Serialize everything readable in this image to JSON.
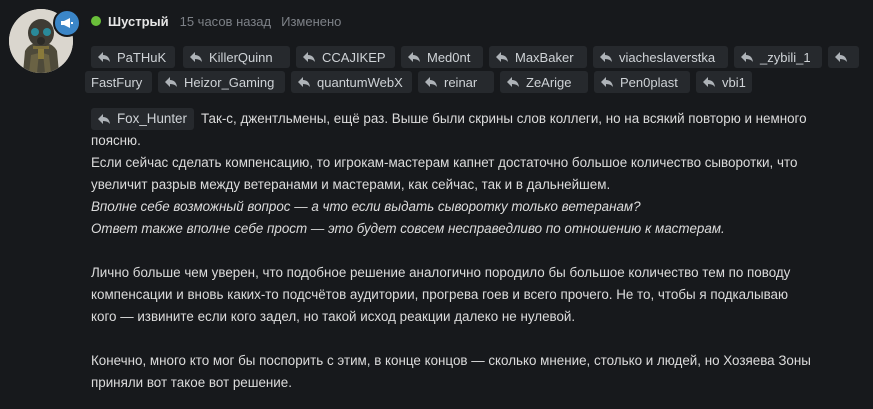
{
  "post": {
    "author": "Шустрый",
    "time": "15 часов назад",
    "edited": "Изменено",
    "mentions": [
      "PaTHuK",
      "KillerQuinn",
      "CCAJIKEP",
      "Med0nt",
      "MaxBaker",
      "viacheslaverstka",
      "_zybili_1",
      "",
      "FastFury",
      "Heizor_Gaming",
      "quantumWebX",
      "reinar",
      "ZeArige",
      "Pen0plast",
      "vbi1"
    ],
    "lead_mention": "Fox_Hunter",
    "p1_line1": "Так-с, джентльмены, ещё раз. Выше были скрины слов коллеги, но на всякий повторю и немного",
    "p1_line2": "поясню.",
    "p1_line3": "Если сейчас сделать компенсацию, то игрокам-мастерам капнет достаточно большое количество сыворотки, что",
    "p1_line4": "увеличит разрыв между ветеранами и мастерами, как сейчас, так и в дальнейшем.",
    "p1_line5": "Вполне себе возможный вопрос — а что если выдать сыворотку только ветеранам?",
    "p1_line6": "Ответ также вполне себе прост — это будет совсем несправедливо по отношению к мастерам.",
    "p2_line1": "Лично больше чем уверен, что подобное решение аналогично породило бы большое количество тем по поводу",
    "p2_line2": "компенсации и вновь каких-то подсчётов аудитории, прогрева гоев и всего прочего. Не то, чтобы я подкалываю",
    "p2_line3": "кого — извините если кого задел, но такой исход реакции далеко не нулевой.",
    "p3_line1": "Конечно, много кто мог бы поспорить с этим, в конце концов — сколько мнение, столько и людей, но Хозяева Зоны",
    "p3_line2": "приняли вот такое вот решение."
  },
  "colors": {
    "online": "#6abf3a",
    "badge": "#3b86c8",
    "chip": "#26292d"
  }
}
